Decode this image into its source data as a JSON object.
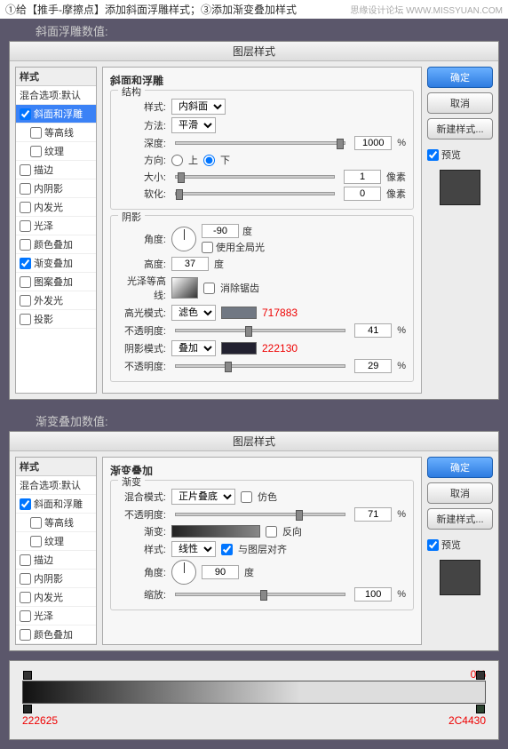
{
  "topbar": {
    "left": "①给【推手-摩擦点】添加斜面浮雕样式；③添加渐变叠加样式",
    "right": "思缘设计论坛 WWW.MISSYUAN.COM"
  },
  "dialog_title": "图层样式",
  "labels": {
    "bevel_values": "斜面浮雕数值:",
    "gradient_values": "渐变叠加数值:"
  },
  "stylelist": {
    "header": "样式",
    "blending": "混合选项:默认",
    "items": [
      {
        "label": "斜面和浮雕",
        "checked": true,
        "sel": true
      },
      {
        "label": "等高线",
        "checked": false,
        "indent": true
      },
      {
        "label": "纹理",
        "checked": false,
        "indent": true
      },
      {
        "label": "描边",
        "checked": false
      },
      {
        "label": "内阴影",
        "checked": false
      },
      {
        "label": "内发光",
        "checked": false
      },
      {
        "label": "光泽",
        "checked": false
      },
      {
        "label": "颜色叠加",
        "checked": false
      },
      {
        "label": "渐变叠加",
        "checked": true
      },
      {
        "label": "图案叠加",
        "checked": false
      },
      {
        "label": "外发光",
        "checked": false
      },
      {
        "label": "投影",
        "checked": false
      }
    ]
  },
  "stylelist2": {
    "items": [
      {
        "label": "斜面和浮雕",
        "checked": true
      },
      {
        "label": "等高线",
        "checked": false,
        "indent": true
      },
      {
        "label": "纹理",
        "checked": false,
        "indent": true
      },
      {
        "label": "描边",
        "checked": false
      },
      {
        "label": "内阴影",
        "checked": false
      },
      {
        "label": "内发光",
        "checked": false
      },
      {
        "label": "光泽",
        "checked": false
      },
      {
        "label": "颜色叠加",
        "checked": false
      }
    ]
  },
  "bevel": {
    "panel_title": "斜面和浮雕",
    "structure": "结构",
    "style_lbl": "样式:",
    "style_val": "内斜面",
    "technique_lbl": "方法:",
    "technique_val": "平滑",
    "depth_lbl": "深度:",
    "depth_val": "1000",
    "pct": "%",
    "direction_lbl": "方向:",
    "up": "上",
    "down": "下",
    "size_lbl": "大小:",
    "size_val": "1",
    "px": "像素",
    "soften_lbl": "软化:",
    "soften_val": "0",
    "shading": "阴影",
    "angle_lbl": "角度:",
    "angle_val": "-90",
    "deg": "度",
    "global_light": "使用全局光",
    "altitude_lbl": "高度:",
    "altitude_val": "37",
    "gloss_lbl": "光泽等高线:",
    "antialias": "消除锯齿",
    "hmode_lbl": "高光模式:",
    "hmode_val": "滤色",
    "hcolor": "#717883",
    "hcolor_annot": "717883",
    "hopacity_lbl": "不透明度:",
    "hopacity_val": "41",
    "smode_lbl": "阴影模式:",
    "smode_val": "叠加",
    "scolor": "#222130",
    "scolor_annot": "222130",
    "sopacity_lbl": "不透明度:",
    "sopacity_val": "29"
  },
  "buttons": {
    "ok": "确定",
    "cancel": "取消",
    "newstyle": "新建样式...",
    "preview": "预览"
  },
  "gradient": {
    "panel_title": "渐变叠加",
    "sub": "渐变",
    "blend_lbl": "混合模式:",
    "blend_val": "正片叠底",
    "dither": "仿色",
    "opacity_lbl": "不透明度:",
    "opacity_val": "71",
    "pct": "%",
    "grad_lbl": "渐变:",
    "reverse": "反向",
    "style_lbl": "样式:",
    "style_val": "线性",
    "align": "与图层对齐",
    "angle_lbl": "角度:",
    "angle_val": "90",
    "deg": "度",
    "scale_lbl": "缩放:",
    "scale_val": "100"
  },
  "grad_editor": {
    "right_annot": "0%",
    "left_color": "222625",
    "right_color": "2C4430"
  }
}
